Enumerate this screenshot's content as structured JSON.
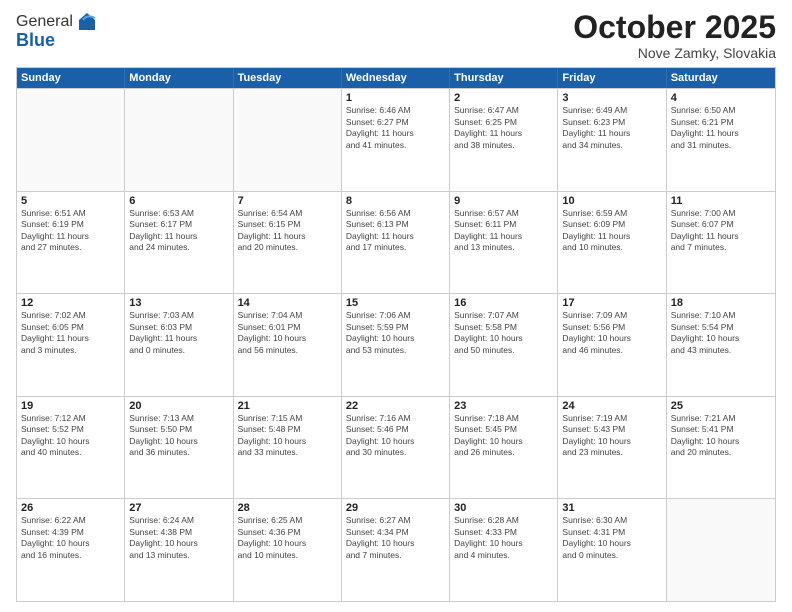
{
  "header": {
    "logo_general": "General",
    "logo_blue": "Blue",
    "month": "October 2025",
    "location": "Nove Zamky, Slovakia"
  },
  "weekdays": [
    "Sunday",
    "Monday",
    "Tuesday",
    "Wednesday",
    "Thursday",
    "Friday",
    "Saturday"
  ],
  "rows": [
    [
      {
        "day": "",
        "text": ""
      },
      {
        "day": "",
        "text": ""
      },
      {
        "day": "",
        "text": ""
      },
      {
        "day": "1",
        "text": "Sunrise: 6:46 AM\nSunset: 6:27 PM\nDaylight: 11 hours\nand 41 minutes."
      },
      {
        "day": "2",
        "text": "Sunrise: 6:47 AM\nSunset: 6:25 PM\nDaylight: 11 hours\nand 38 minutes."
      },
      {
        "day": "3",
        "text": "Sunrise: 6:49 AM\nSunset: 6:23 PM\nDaylight: 11 hours\nand 34 minutes."
      },
      {
        "day": "4",
        "text": "Sunrise: 6:50 AM\nSunset: 6:21 PM\nDaylight: 11 hours\nand 31 minutes."
      }
    ],
    [
      {
        "day": "5",
        "text": "Sunrise: 6:51 AM\nSunset: 6:19 PM\nDaylight: 11 hours\nand 27 minutes."
      },
      {
        "day": "6",
        "text": "Sunrise: 6:53 AM\nSunset: 6:17 PM\nDaylight: 11 hours\nand 24 minutes."
      },
      {
        "day": "7",
        "text": "Sunrise: 6:54 AM\nSunset: 6:15 PM\nDaylight: 11 hours\nand 20 minutes."
      },
      {
        "day": "8",
        "text": "Sunrise: 6:56 AM\nSunset: 6:13 PM\nDaylight: 11 hours\nand 17 minutes."
      },
      {
        "day": "9",
        "text": "Sunrise: 6:57 AM\nSunset: 6:11 PM\nDaylight: 11 hours\nand 13 minutes."
      },
      {
        "day": "10",
        "text": "Sunrise: 6:59 AM\nSunset: 6:09 PM\nDaylight: 11 hours\nand 10 minutes."
      },
      {
        "day": "11",
        "text": "Sunrise: 7:00 AM\nSunset: 6:07 PM\nDaylight: 11 hours\nand 7 minutes."
      }
    ],
    [
      {
        "day": "12",
        "text": "Sunrise: 7:02 AM\nSunset: 6:05 PM\nDaylight: 11 hours\nand 3 minutes."
      },
      {
        "day": "13",
        "text": "Sunrise: 7:03 AM\nSunset: 6:03 PM\nDaylight: 11 hours\nand 0 minutes."
      },
      {
        "day": "14",
        "text": "Sunrise: 7:04 AM\nSunset: 6:01 PM\nDaylight: 10 hours\nand 56 minutes."
      },
      {
        "day": "15",
        "text": "Sunrise: 7:06 AM\nSunset: 5:59 PM\nDaylight: 10 hours\nand 53 minutes."
      },
      {
        "day": "16",
        "text": "Sunrise: 7:07 AM\nSunset: 5:58 PM\nDaylight: 10 hours\nand 50 minutes."
      },
      {
        "day": "17",
        "text": "Sunrise: 7:09 AM\nSunset: 5:56 PM\nDaylight: 10 hours\nand 46 minutes."
      },
      {
        "day": "18",
        "text": "Sunrise: 7:10 AM\nSunset: 5:54 PM\nDaylight: 10 hours\nand 43 minutes."
      }
    ],
    [
      {
        "day": "19",
        "text": "Sunrise: 7:12 AM\nSunset: 5:52 PM\nDaylight: 10 hours\nand 40 minutes."
      },
      {
        "day": "20",
        "text": "Sunrise: 7:13 AM\nSunset: 5:50 PM\nDaylight: 10 hours\nand 36 minutes."
      },
      {
        "day": "21",
        "text": "Sunrise: 7:15 AM\nSunset: 5:48 PM\nDaylight: 10 hours\nand 33 minutes."
      },
      {
        "day": "22",
        "text": "Sunrise: 7:16 AM\nSunset: 5:46 PM\nDaylight: 10 hours\nand 30 minutes."
      },
      {
        "day": "23",
        "text": "Sunrise: 7:18 AM\nSunset: 5:45 PM\nDaylight: 10 hours\nand 26 minutes."
      },
      {
        "day": "24",
        "text": "Sunrise: 7:19 AM\nSunset: 5:43 PM\nDaylight: 10 hours\nand 23 minutes."
      },
      {
        "day": "25",
        "text": "Sunrise: 7:21 AM\nSunset: 5:41 PM\nDaylight: 10 hours\nand 20 minutes."
      }
    ],
    [
      {
        "day": "26",
        "text": "Sunrise: 6:22 AM\nSunset: 4:39 PM\nDaylight: 10 hours\nand 16 minutes."
      },
      {
        "day": "27",
        "text": "Sunrise: 6:24 AM\nSunset: 4:38 PM\nDaylight: 10 hours\nand 13 minutes."
      },
      {
        "day": "28",
        "text": "Sunrise: 6:25 AM\nSunset: 4:36 PM\nDaylight: 10 hours\nand 10 minutes."
      },
      {
        "day": "29",
        "text": "Sunrise: 6:27 AM\nSunset: 4:34 PM\nDaylight: 10 hours\nand 7 minutes."
      },
      {
        "day": "30",
        "text": "Sunrise: 6:28 AM\nSunset: 4:33 PM\nDaylight: 10 hours\nand 4 minutes."
      },
      {
        "day": "31",
        "text": "Sunrise: 6:30 AM\nSunset: 4:31 PM\nDaylight: 10 hours\nand 0 minutes."
      },
      {
        "day": "",
        "text": ""
      }
    ]
  ]
}
